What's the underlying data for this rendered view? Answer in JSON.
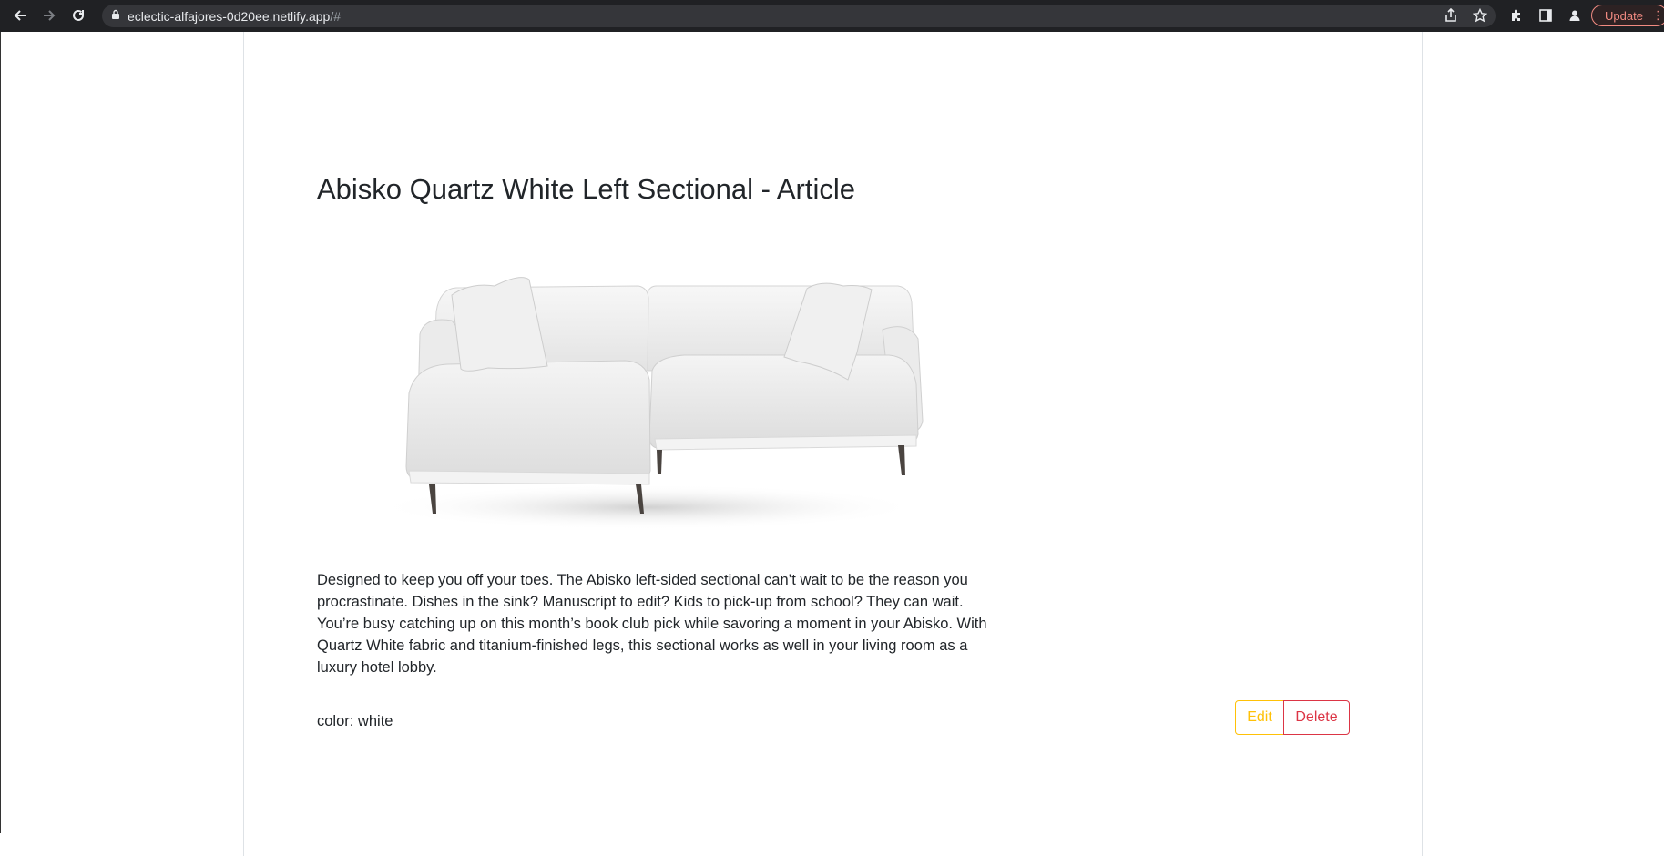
{
  "browser": {
    "url_host": "eclectic-alfajores-0d20ee.netlify.app",
    "url_path": "/#",
    "update_label": "Update",
    "icons": [
      "back-icon",
      "forward-icon",
      "reload-icon",
      "lock-icon",
      "share-icon",
      "star-icon",
      "extensions-icon",
      "side-panel-icon",
      "profile-icon",
      "more-icon"
    ]
  },
  "article": {
    "title": "Abisko Quartz White Left Sectional - Article",
    "description_lines": [
      "Designed to keep you off your toes. The Abisko left-sided sectional can’t wait to be the reason you",
      "procrastinate. Dishes in the sink? Manuscript to edit? Kids to pick-up from school? They can wait.",
      "You’re busy catching up on this month’s book club pick while savoring a moment in your Abisko. With",
      "Quartz White fabric and titanium-finished legs, this sectional works as well in your living room as a",
      "luxury hotel lobby."
    ],
    "color_text": "color: white",
    "edit_label": "Edit",
    "delete_label": "Delete"
  },
  "colors": {
    "edit_accent": "#ffc107",
    "delete_accent": "#dc3545",
    "chrome_bg": "#202124"
  }
}
